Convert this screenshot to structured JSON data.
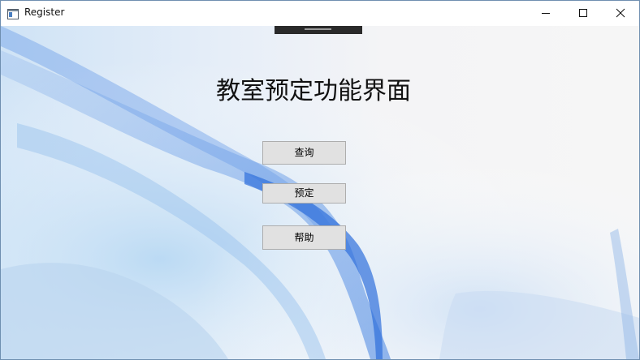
{
  "window": {
    "title": "Register",
    "icon": "app-window-icon",
    "controls": {
      "minimize_icon": "minimize-icon",
      "maximize_icon": "maximize-icon",
      "close_icon": "close-icon"
    }
  },
  "main": {
    "heading": "教室预定功能界面",
    "buttons": {
      "query": "查询",
      "reserve": "预定",
      "help": "帮助"
    }
  },
  "colors": {
    "background": "#f3f3f3",
    "button_face": "#e1e1e1",
    "button_border": "#adadad",
    "accent_blue": "#4a86e0"
  }
}
